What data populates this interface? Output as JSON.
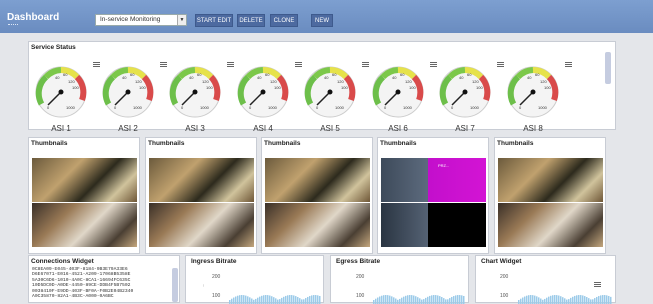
{
  "header": {
    "title": "Dashboard",
    "monitoring_select": "In-service Monitoring",
    "buttons": [
      "START EDIT",
      "DELETE",
      "CLONE",
      "NEW"
    ]
  },
  "service_status": {
    "title": "Service Status",
    "gauge_ticks": [
      "40",
      "60",
      "80",
      "120",
      "100",
      "0",
      "1000"
    ],
    "gauges": [
      "ASI 1",
      "ASI 2",
      "ASI 3",
      "ASI 4",
      "ASI 5",
      "ASI 6",
      "ASI 7",
      "ASI 8"
    ]
  },
  "thumbnails": {
    "title": "Thumbnails",
    "count": 5,
    "magenta_label": "PRZ..."
  },
  "connections": {
    "title": "Connections Widget",
    "lines": [
      "0C8EA09-E045-403F-8184-9B3E79A33E6",
      "D6E67071-E016-4521-A209-17068B5358E",
      "5A30C6D6-1010-4A0C-8CA1-16694FC635C",
      "10D5DC0D-A0DE-4450-89CE-DDB4F5B7502",
      "0038410F-E9DD-403F-BF0A-F0B2E04B2340",
      "A0C35870-82A1-4B3C-A000-0A6BC"
    ]
  },
  "ingress": {
    "title": "Ingress Bitrate",
    "ticks": [
      "200",
      "100"
    ]
  },
  "egress": {
    "title": "Egress Bitrate",
    "ticks": [
      "200",
      "100"
    ]
  },
  "chart_widget": {
    "title": "Chart Widget",
    "ticks": [
      "200",
      "100"
    ]
  }
}
